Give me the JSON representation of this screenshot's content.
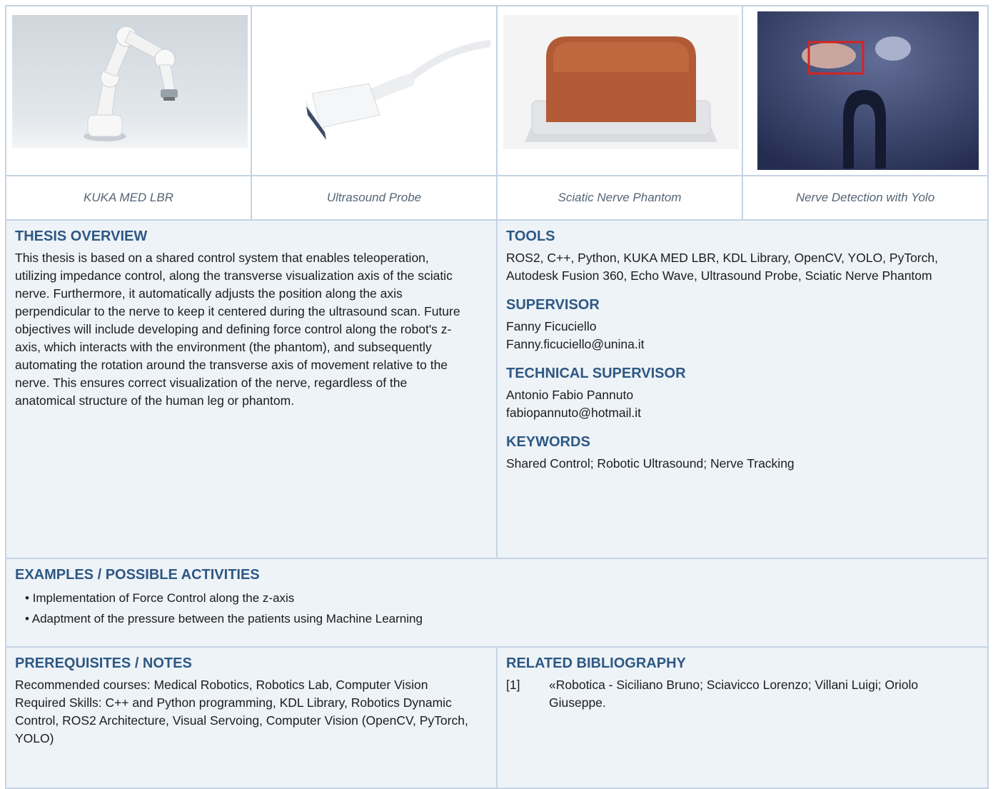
{
  "images": [
    {
      "caption": "KUKA MED LBR",
      "icon": "robot-arm-image"
    },
    {
      "caption": "Ultrasound Probe",
      "icon": "ultrasound-probe-image"
    },
    {
      "caption": "Sciatic Nerve Phantom",
      "icon": "phantom-image"
    },
    {
      "caption": "Nerve Detection with Yolo",
      "icon": "ultrasound-scan-image"
    }
  ],
  "overview": {
    "title": "THESIS OVERVIEW",
    "text": "This thesis is based on a shared control system that enables teleoperation, utilizing impedance control, along the transverse visualization axis of the sciatic nerve. Furthermore, it automatically adjusts the position along the axis perpendicular to the nerve to keep it centered during the ultrasound scan. Future objectives will include developing and defining force control along the robot's z-axis, which interacts with the environment (the phantom), and subsequently automating the rotation around the transverse axis of movement relative to the nerve. This ensures correct visualization of the nerve, regardless of the anatomical structure of the human leg or phantom."
  },
  "tools": {
    "title": "TOOLS",
    "text": "ROS2, C++, Python, KUKA MED LBR, KDL Library, OpenCV, YOLO, PyTorch, Autodesk Fusion 360, Echo Wave, Ultrasound Probe, Sciatic Nerve Phantom"
  },
  "supervisor": {
    "title": "SUPERVISOR",
    "name": "Fanny Ficuciello",
    "email": "Fanny.ficuciello@unina.it"
  },
  "technical_supervisor": {
    "title": "TECHNICAL SUPERVISOR",
    "name": "Antonio Fabio Pannuto",
    "email": "fabiopannuto@hotmail.it"
  },
  "keywords": {
    "title": "KEYWORDS",
    "text": "Shared Control; Robotic Ultrasound; Nerve Tracking"
  },
  "activities": {
    "title": "EXAMPLES / POSSIBLE ACTIVITIES",
    "items": [
      "• Implementation of Force Control along the z-axis",
      "• Adaptment of the pressure between the patients using Machine Learning"
    ]
  },
  "prerequisites": {
    "title": "PREREQUISITES / NOTES",
    "courses": "Recommended courses: Medical Robotics, Robotics Lab, Computer Vision",
    "skills": "Required Skills: C++ and Python programming, KDL Library, Robotics Dynamic Control, ROS2 Architecture, Visual Servoing, Computer Vision (OpenCV, PyTorch, YOLO)"
  },
  "bibliography": {
    "title": "RELATED BIBLIOGRAPHY",
    "number": "[1]",
    "entry": "«Robotica - Siciliano Bruno; Sciavicco Lorenzo; Villani Luigi; Oriolo Giuseppe."
  },
  "colors": {
    "heading": "#2e5883",
    "panel_bg": "#eef3f8",
    "border": "#c5d3e3"
  }
}
